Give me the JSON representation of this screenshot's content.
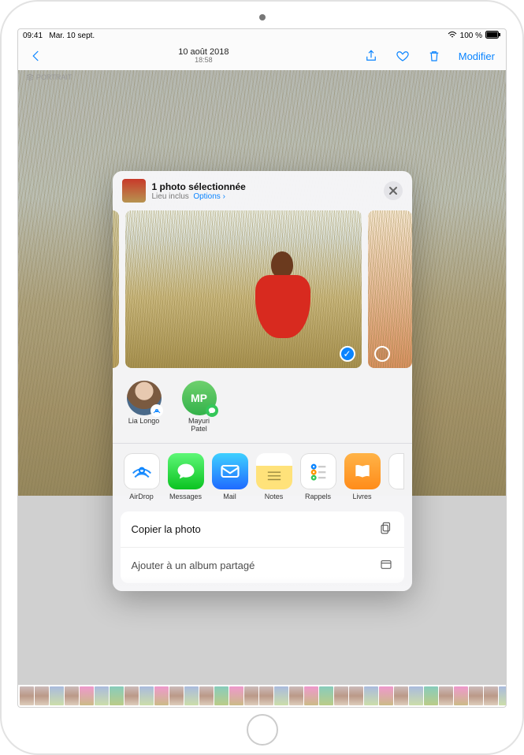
{
  "statusbar": {
    "time": "09:41",
    "date": "Mar. 10 sept.",
    "battery": "100 %"
  },
  "navbar": {
    "title": "10 août 2018",
    "subtitle": "18:58",
    "modify": "Modifier"
  },
  "badge": "PORTRAIT",
  "sheet": {
    "title": "1 photo sélectionnée",
    "subtitle_prefix": "Lieu inclus",
    "options": "Options",
    "people": [
      {
        "name": "Lia Longo",
        "initials": "",
        "type": "photo",
        "badge": "airdrop"
      },
      {
        "name": "Mayuri Patel",
        "initials": "MP",
        "type": "initials",
        "badge": "messages"
      }
    ],
    "apps": [
      {
        "label": "AirDrop",
        "kind": "airdrop"
      },
      {
        "label": "Messages",
        "kind": "messages"
      },
      {
        "label": "Mail",
        "kind": "mail"
      },
      {
        "label": "Notes",
        "kind": "notes"
      },
      {
        "label": "Rappels",
        "kind": "rappels"
      },
      {
        "label": "Livres",
        "kind": "livres"
      }
    ],
    "actions": {
      "copy": "Copier la photo",
      "shared_album": "Ajouter à un album partagé"
    }
  }
}
